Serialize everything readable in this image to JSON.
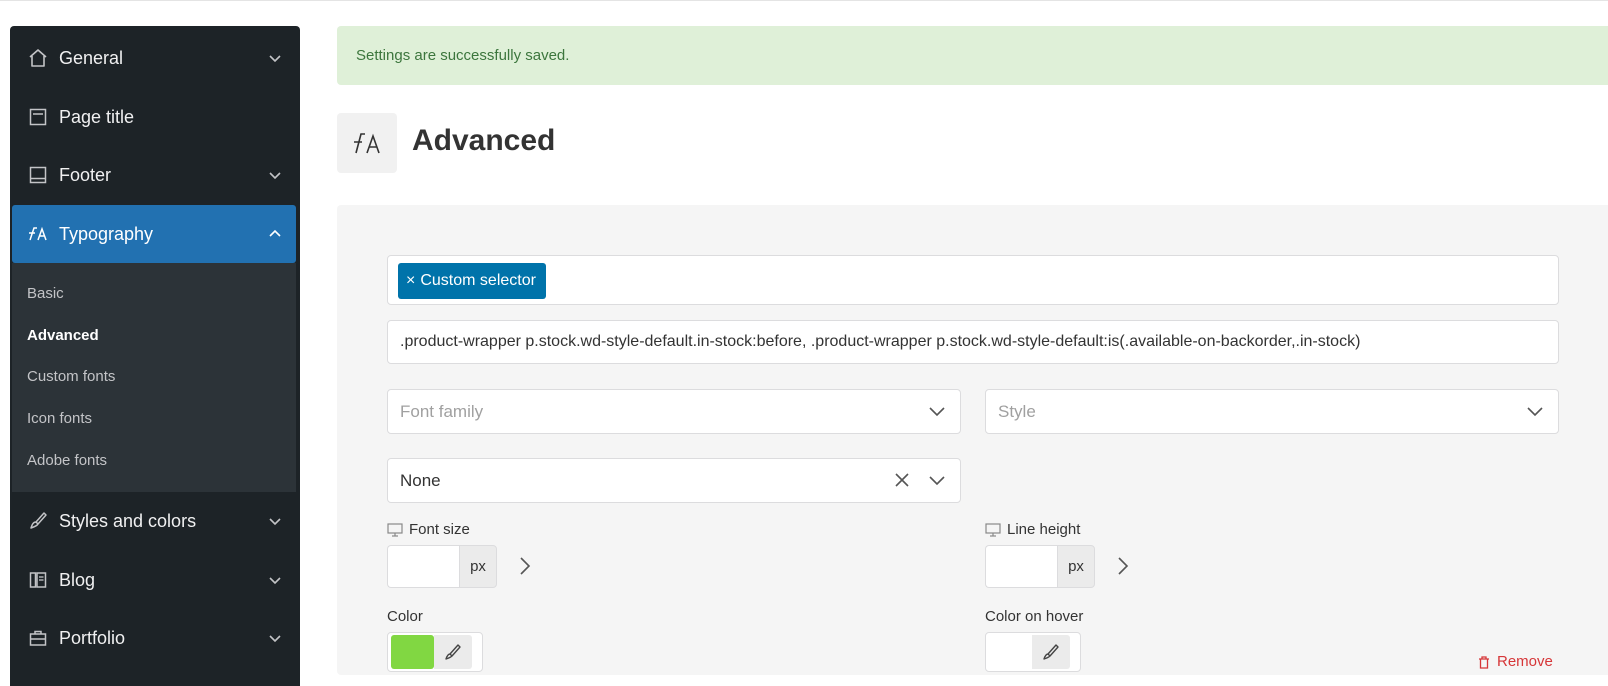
{
  "sidebar": {
    "items": [
      {
        "label": "General",
        "icon": "home-icon"
      },
      {
        "label": "Page title",
        "icon": "page-title-icon"
      },
      {
        "label": "Footer",
        "icon": "footer-icon"
      },
      {
        "label": "Typography",
        "icon": "typography-icon"
      },
      {
        "label": "Styles and colors",
        "icon": "brush-icon"
      },
      {
        "label": "Blog",
        "icon": "blog-icon"
      },
      {
        "label": "Portfolio",
        "icon": "portfolio-icon"
      }
    ],
    "typography_submenu": [
      "Basic",
      "Advanced",
      "Custom fonts",
      "Icon fonts",
      "Adobe fonts"
    ]
  },
  "notice": "Settings are successfully saved.",
  "page": {
    "title": "Advanced"
  },
  "panel": {
    "tag_label": "Custom selector",
    "tag_remove": "×",
    "selector_value": ".product-wrapper p.stock.wd-style-default.in-stock:before, .product-wrapper p.stock.wd-style-default:is(.available-on-backorder,.in-stock)",
    "font_family_placeholder": "Font family",
    "style_placeholder": "Style",
    "transform_value": "None",
    "font_size_label": "Font size",
    "line_height_label": "Line height",
    "unit": "px",
    "color_label": "Color",
    "color_hover_label": "Color on hover",
    "color_value": "#81d742",
    "remove_label": "Remove"
  }
}
